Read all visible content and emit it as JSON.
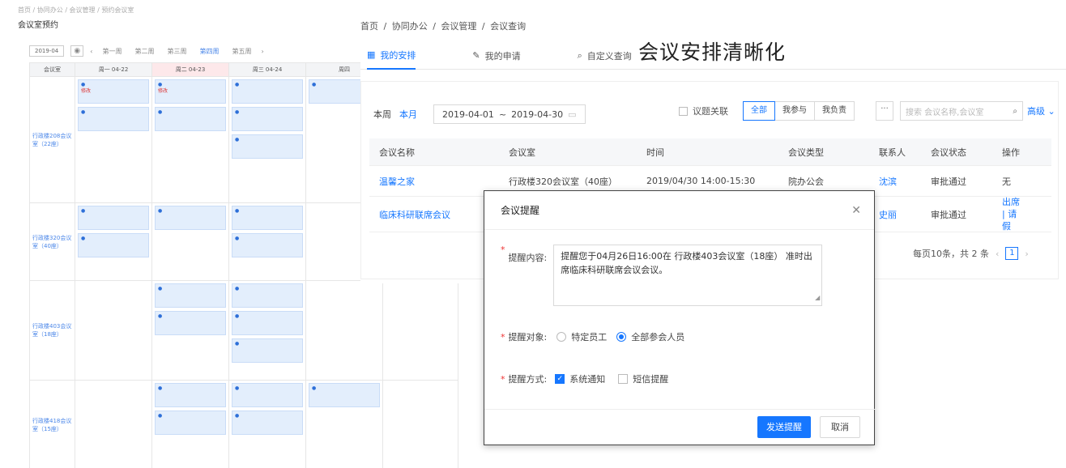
{
  "calendar_bg": {
    "breadcrumb": "首页 / 协同办公 / 会议管理 / 预约会议室",
    "title": "会议室预约",
    "date_value": "2019-04",
    "weeks": [
      "第一周",
      "第二周",
      "第三周",
      "第四周",
      "第五周"
    ],
    "active_week": "第四周",
    "col_headers": [
      "会议室",
      "周一 04-22",
      "周二 04-23",
      "周三 04-24",
      "周四"
    ],
    "rooms": [
      "行政楼208会议室（22座）",
      "行政楼320会议室（40座）",
      "行政楼403会议室（18座）",
      "行政楼418会议室（15座）"
    ],
    "event_edit": "修改"
  },
  "breadcrumb": [
    "首页",
    "协同办公",
    "会议管理",
    "会议查询"
  ],
  "tabs": [
    {
      "label": "我的安排",
      "icon": "calendar-icon",
      "active": true
    },
    {
      "label": "我的申请",
      "icon": "edit-icon",
      "active": false
    },
    {
      "label": "自定义查询",
      "icon": "search-icon",
      "active": false
    }
  ],
  "headline": "会议安排清晰化",
  "filters": {
    "this_week": "本周",
    "this_month": "本月",
    "date_start": "2019-04-01",
    "date_sep": "~",
    "date_end": "2019-04-30",
    "topic_related": "议题关联",
    "segments": [
      "全部",
      "我参与",
      "我负责"
    ],
    "more": "···",
    "search_placeholder": "搜索 会议名称,会议室",
    "advanced": "高级"
  },
  "table": {
    "columns": [
      "会议名称",
      "会议室",
      "时间",
      "会议类型",
      "联系人",
      "会议状态",
      "操作"
    ],
    "rows": [
      {
        "name": "温馨之家",
        "room": "行政楼320会议室（40座）",
        "time": "2019/04/30 14:00-15:30",
        "type": "院办公会",
        "contact": "沈滨",
        "status": "审批通过",
        "action": "无"
      },
      {
        "name": "临床科研联席会议",
        "room": "",
        "time": "",
        "type": "",
        "contact": "史丽",
        "status": "审批通过",
        "action": "出席 | 请假"
      }
    ]
  },
  "pagination": {
    "summary": "每页10条，共 2 条",
    "current": "1"
  },
  "modal": {
    "title": "会议提醒",
    "content_label": "提醒内容:",
    "content_value": "提醒您于04月26日16:00在 行政楼403会议室（18座） 准时出席临床科研联席会议会议。",
    "target_label": "提醒对象:",
    "target_options": [
      "特定员工",
      "全部参会人员"
    ],
    "target_selected": "全部参会人员",
    "method_label": "提醒方式:",
    "method_options": [
      {
        "label": "系统通知",
        "checked": true
      },
      {
        "label": "短信提醒",
        "checked": false
      }
    ],
    "send": "发送提醒",
    "cancel": "取消"
  }
}
